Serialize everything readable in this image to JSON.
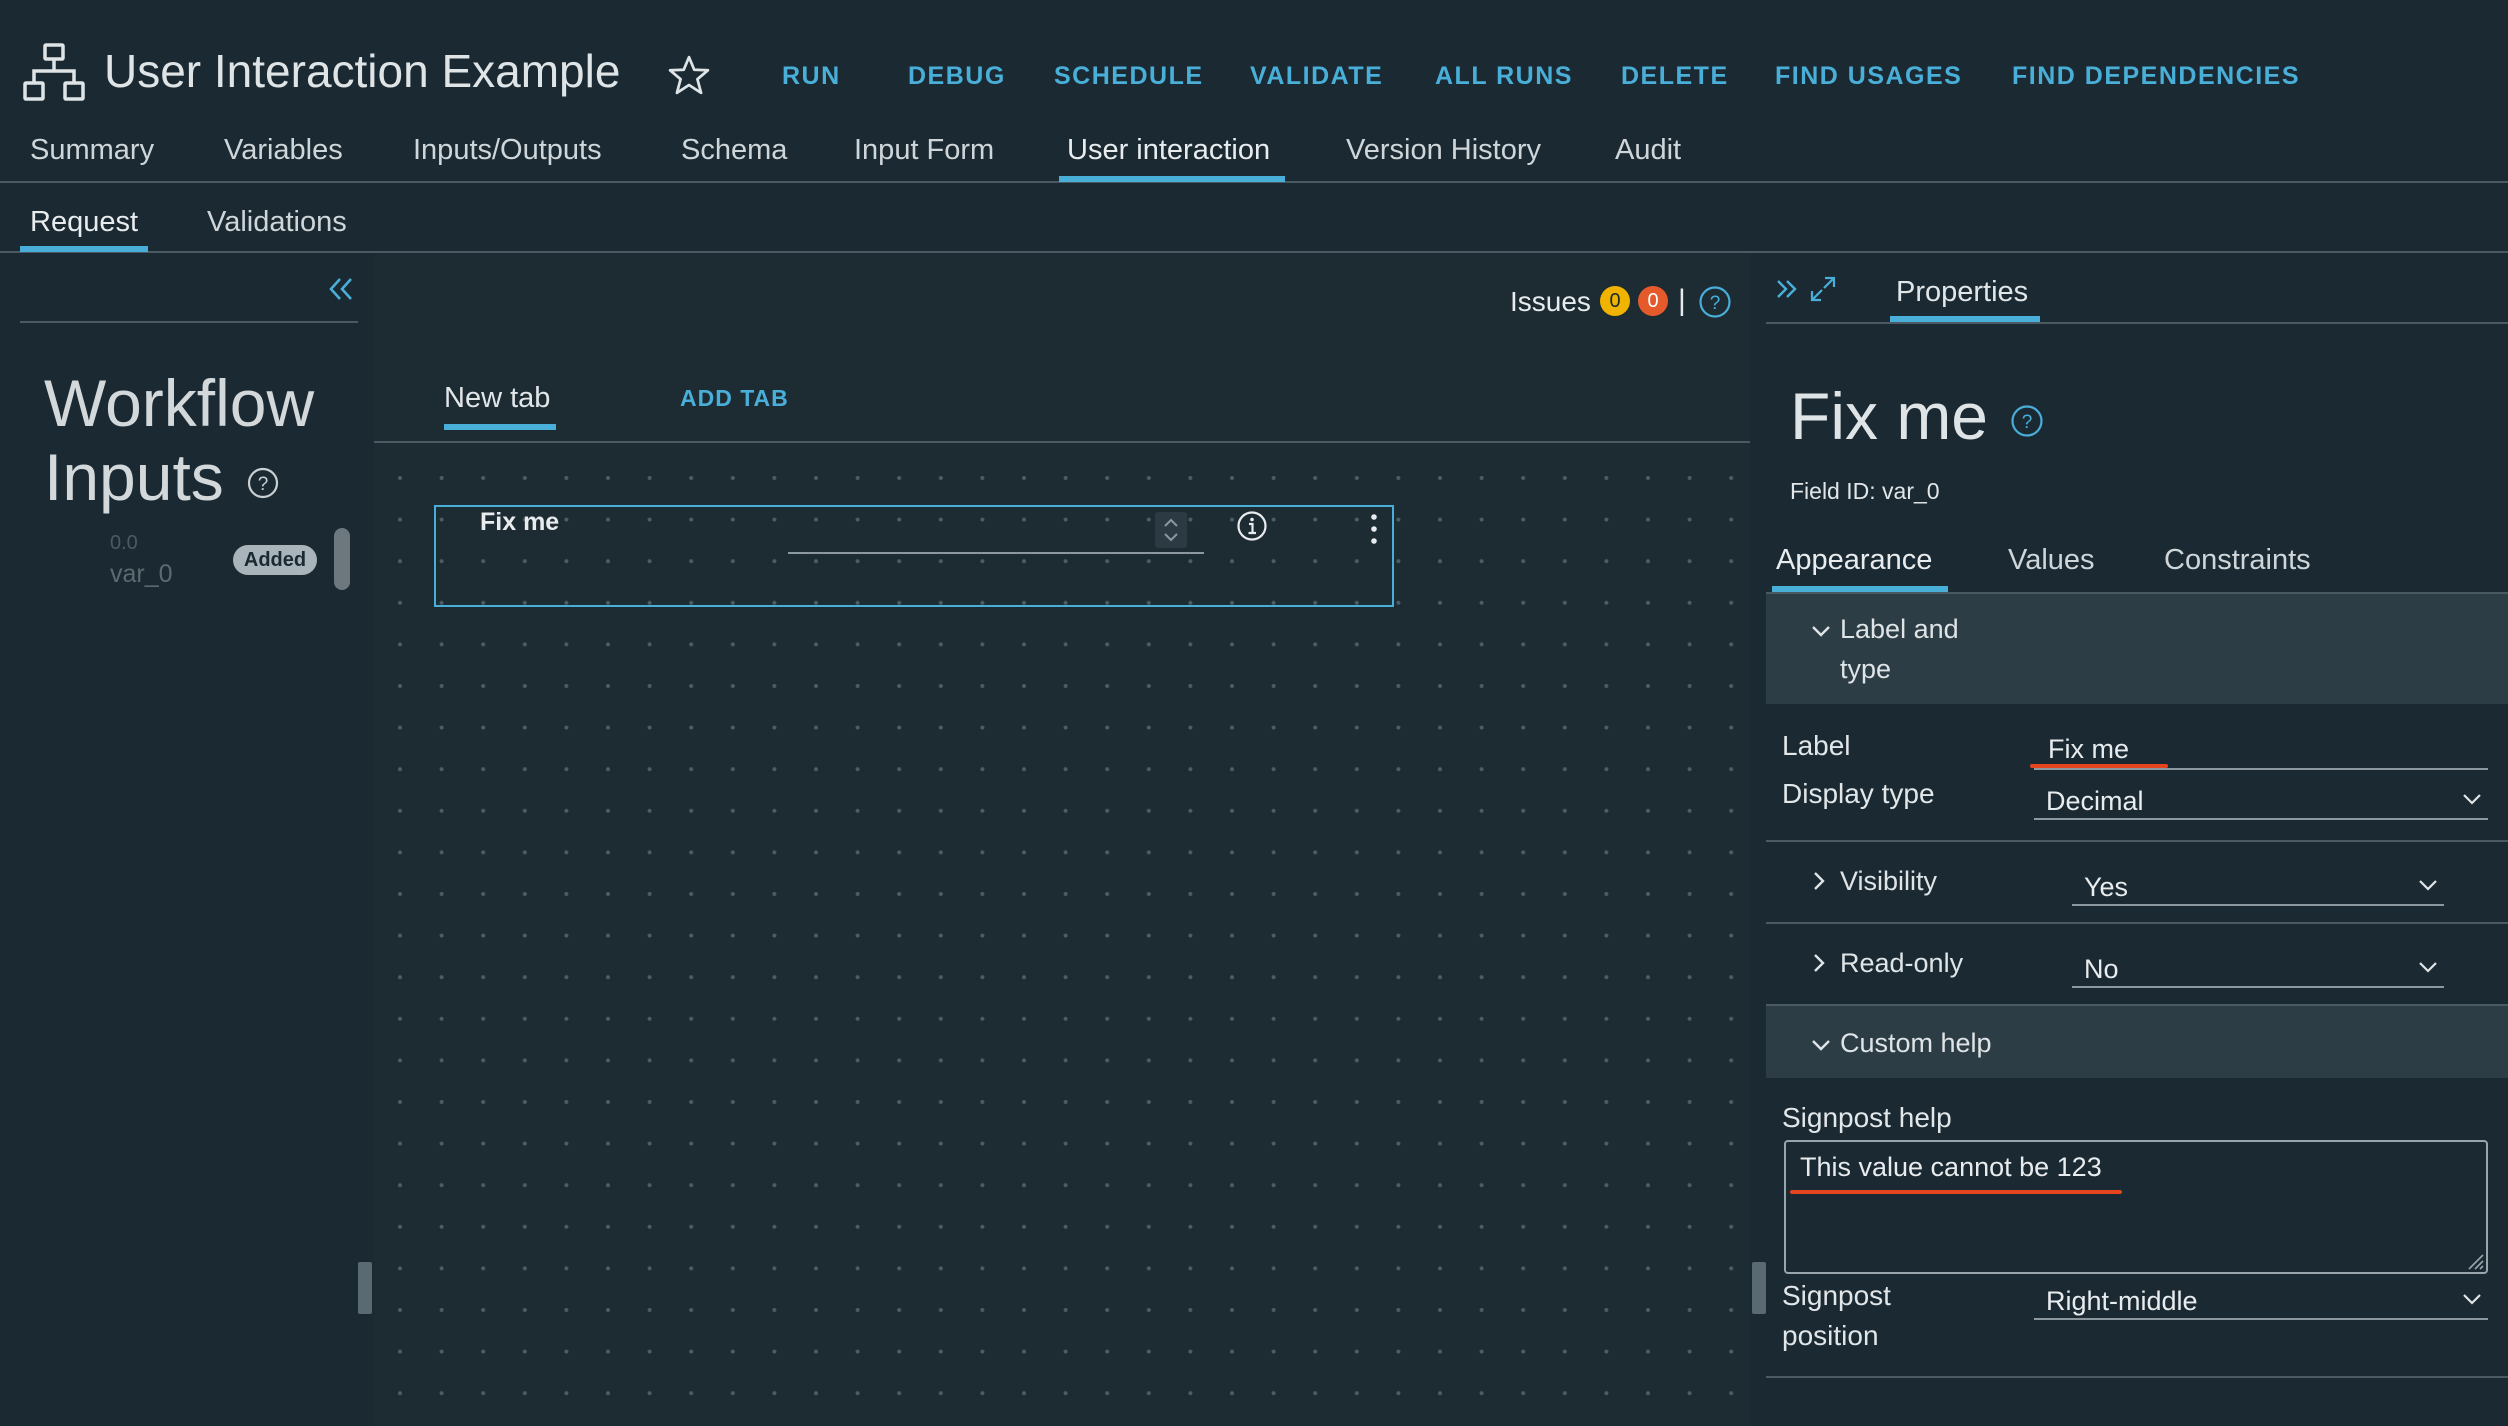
{
  "header": {
    "title": "User Interaction Example",
    "actions": [
      "RUN",
      "DEBUG",
      "SCHEDULE",
      "VALIDATE",
      "ALL RUNS",
      "DELETE",
      "FIND USAGES",
      "FIND DEPENDENCIES"
    ]
  },
  "main_tabs": [
    "Summary",
    "Variables",
    "Inputs/Outputs",
    "Schema",
    "Input Form",
    "User interaction",
    "Version History",
    "Audit"
  ],
  "main_tabs_selected": "User interaction",
  "sub_tabs": [
    "Request",
    "Validations"
  ],
  "sub_tabs_selected": "Request",
  "left_panel": {
    "title": "Workflow Inputs",
    "variable": {
      "version": "0.0",
      "name": "var_0",
      "badge": "Added"
    }
  },
  "canvas": {
    "issues_label": "Issues",
    "warnings": "0",
    "errors": "0",
    "separator": "|",
    "tabs": [
      "New tab"
    ],
    "add_tab_label": "ADD TAB",
    "field": {
      "label": "Fix me"
    }
  },
  "properties": {
    "tab_label": "Properties",
    "title": "Fix me",
    "field_id": "Field ID: var_0",
    "tabs": [
      "Appearance",
      "Values",
      "Constraints"
    ],
    "tabs_selected": "Appearance",
    "label_and_type": {
      "section_line1": "Label and",
      "section_line2": "type",
      "label_title": "Label",
      "label_value": "Fix me",
      "display_type_title": "Display type",
      "display_type_value": "Decimal"
    },
    "visibility": {
      "title": "Visibility",
      "value": "Yes"
    },
    "read_only": {
      "title": "Read-only",
      "value": "No"
    },
    "custom_help": {
      "section": "Custom help",
      "signpost_help_title": "Signpost help",
      "signpost_help_value": "This value cannot be 123",
      "signpost_position_line1": "Signpost",
      "signpost_position_line2": "position",
      "signpost_position_value": "Right-middle"
    }
  },
  "colors": {
    "background": "#1b2a32",
    "accent": "#49afd9",
    "warning": "#f0b400",
    "error": "#e45a2a",
    "annotation": "#e4451f"
  }
}
